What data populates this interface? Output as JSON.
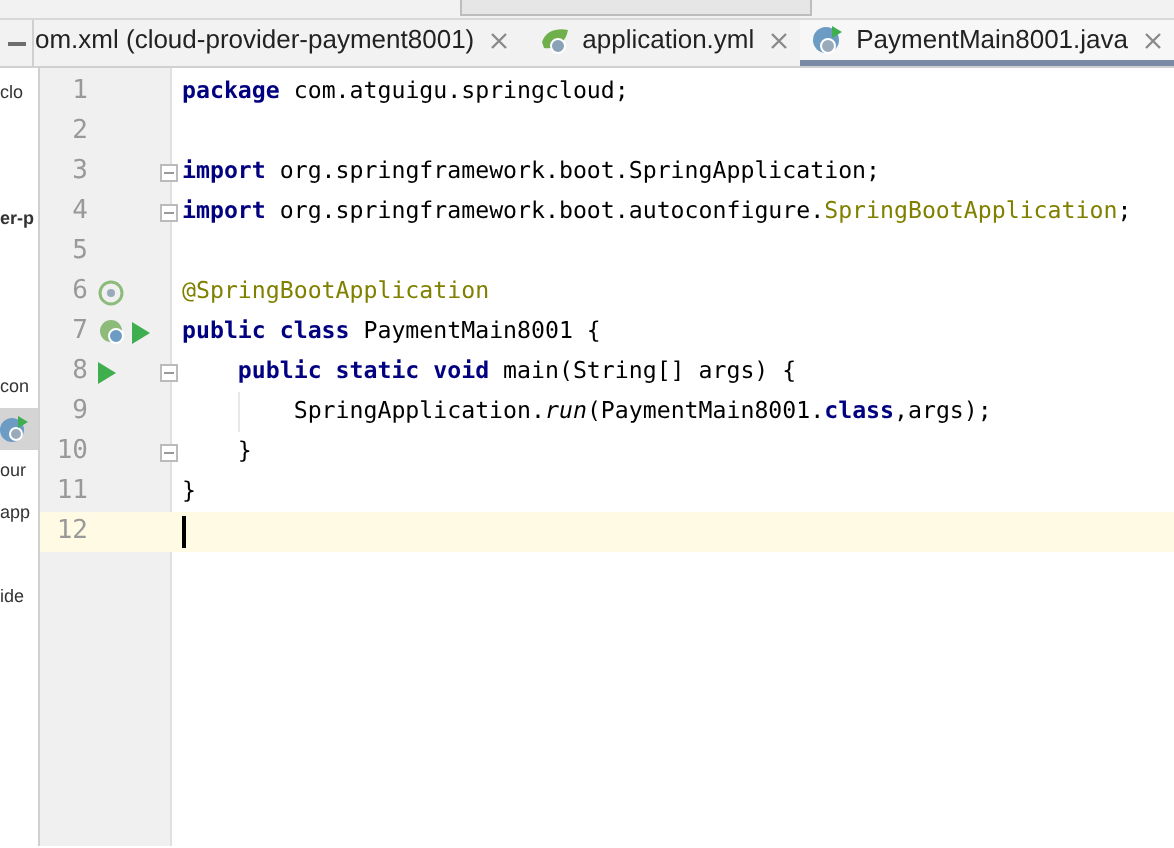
{
  "tabs": [
    {
      "label": "om.xml (cloud-provider-payment8001)",
      "selected": false,
      "kind": "plain"
    },
    {
      "label": "application.yml",
      "selected": false,
      "kind": "yaml"
    },
    {
      "label": "PaymentMain8001.java",
      "selected": true,
      "kind": "java"
    }
  ],
  "project_tree": [
    {
      "label": "clo",
      "bold": false,
      "selected": false
    },
    {
      "label": "er-p",
      "bold": true,
      "selected": false
    },
    {
      "label": "con",
      "bold": false,
      "selected": false
    },
    {
      "kind": "class",
      "selected": true
    },
    {
      "label": "our",
      "bold": false,
      "selected": false
    },
    {
      "label": "app",
      "bold": false,
      "selected": false
    },
    {
      "label": "ide",
      "bold": false,
      "selected": false
    }
  ],
  "lines": [
    {
      "number": "1",
      "tokens": [
        {
          "kind": "keyword",
          "text": "package"
        },
        {
          "kind": "plain",
          "text": " com.atguigu.springcloud;"
        }
      ]
    },
    {
      "number": "2"
    },
    {
      "number": "3",
      "fold": true,
      "tokens": [
        {
          "kind": "keyword",
          "text": "import"
        },
        {
          "kind": "plain",
          "text": " org.springframework.boot.SpringApplication;"
        }
      ]
    },
    {
      "number": "4",
      "fold": true,
      "tokens": [
        {
          "kind": "keyword",
          "text": "import"
        },
        {
          "kind": "plain",
          "text": " org.springframework.boot.autoconfigure."
        },
        {
          "kind": "annotation",
          "text": "SpringBootApplication"
        },
        {
          "kind": "plain",
          "text": ";"
        }
      ]
    },
    {
      "number": "5"
    },
    {
      "number": "6",
      "gutter": [
        {
          "kind": "bean"
        }
      ],
      "tokens": [
        {
          "kind": "annotation",
          "text": "@SpringBootApplication"
        }
      ]
    },
    {
      "number": "7",
      "gutter": [
        {
          "kind": "bean-class"
        },
        {
          "kind": "run"
        }
      ],
      "tokens": [
        {
          "kind": "keyword",
          "text": "public class"
        },
        {
          "kind": "plain",
          "text": " PaymentMain8001 {"
        }
      ]
    },
    {
      "number": "8",
      "gutter": [
        {
          "kind": "run"
        }
      ],
      "fold": true,
      "tokens": [
        {
          "kind": "keyword",
          "text": "    public static void"
        },
        {
          "kind": "plain",
          "text": " main(String[] args) {"
        }
      ]
    },
    {
      "number": "9",
      "tokens": [
        {
          "kind": "plain",
          "text": "        SpringApplication."
        },
        {
          "kind": "italic",
          "text": "run"
        },
        {
          "kind": "plain",
          "text": "(PaymentMain8001."
        },
        {
          "kind": "keyword",
          "text": "class"
        },
        {
          "kind": "plain",
          "text": ",args);"
        }
      ]
    },
    {
      "number": "10",
      "fold": true,
      "tokens": [
        {
          "kind": "plain",
          "text": "    }"
        }
      ]
    },
    {
      "number": "11",
      "tokens": [
        {
          "kind": "plain",
          "text": "}"
        }
      ]
    },
    {
      "number": "12",
      "current": true
    }
  ]
}
